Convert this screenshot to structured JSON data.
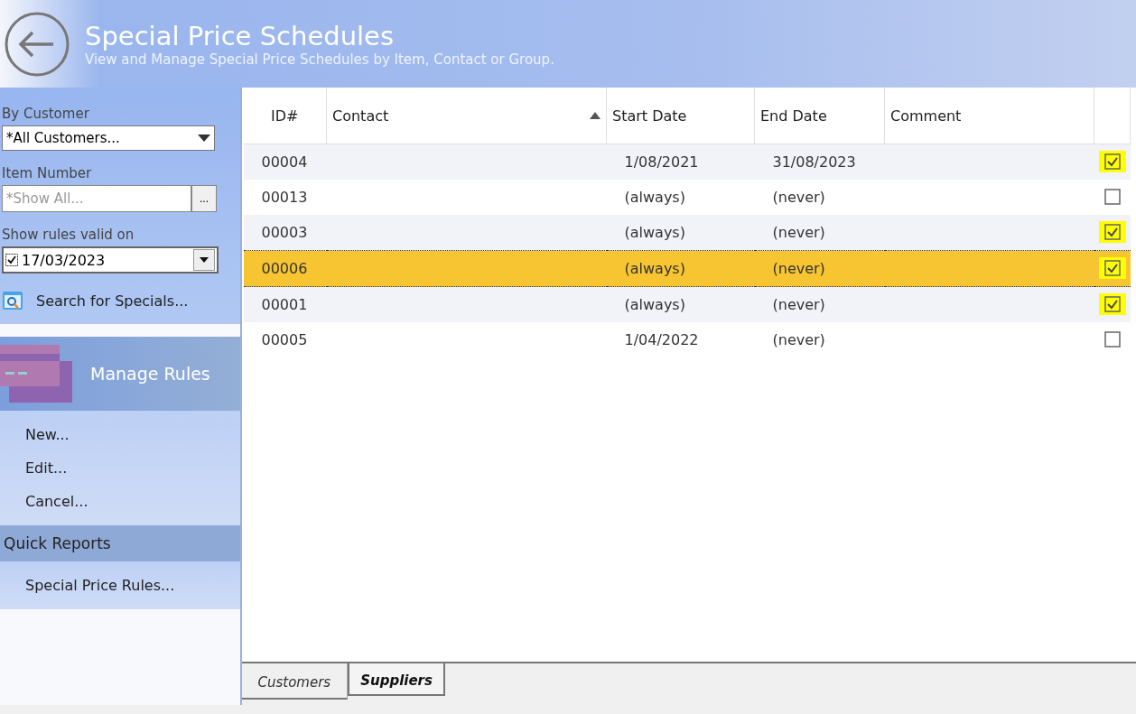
{
  "header": {
    "title": "Special Price Schedules",
    "subtitle": "View and Manage Special Price Schedules by Item, Contact or Group."
  },
  "filters": {
    "customer_label": "By Customer",
    "customer_value": "*All Customers...",
    "item_label": "Item Number",
    "item_placeholder": "*Show All...",
    "browse_button": "...",
    "date_label": "Show rules valid on",
    "date_checked": true,
    "date_value": "17/03/2023",
    "search_link": "Search for Specials..."
  },
  "manage_rules": {
    "title": "Manage Rules",
    "items": [
      "New...",
      "Edit...",
      "Cancel..."
    ]
  },
  "quick_reports": {
    "title": "Quick Reports",
    "items": [
      "Special Price Rules..."
    ]
  },
  "table": {
    "columns": [
      "ID#",
      "Contact",
      "Start Date",
      "End Date",
      "Comment"
    ],
    "rows": [
      {
        "id": "00004",
        "contact": "",
        "start": "1/08/2021",
        "end": "31/08/2023",
        "comment": "",
        "checked": true,
        "highlighted": true,
        "selected": false
      },
      {
        "id": "00013",
        "contact": "",
        "start": "(always)",
        "end": "(never)",
        "comment": "",
        "checked": false,
        "highlighted": false,
        "selected": false
      },
      {
        "id": "00003",
        "contact": "",
        "start": "(always)",
        "end": "(never)",
        "comment": "",
        "checked": true,
        "highlighted": true,
        "selected": false
      },
      {
        "id": "00006",
        "contact": "",
        "start": "(always)",
        "end": "(never)",
        "comment": "",
        "checked": true,
        "highlighted": true,
        "selected": true
      },
      {
        "id": "00001",
        "contact": "",
        "start": "(always)",
        "end": "(never)",
        "comment": "",
        "checked": true,
        "highlighted": true,
        "selected": false
      },
      {
        "id": "00005",
        "contact": "",
        "start": "1/04/2022",
        "end": "(never)",
        "comment": "",
        "checked": false,
        "highlighted": false,
        "selected": false
      }
    ]
  },
  "tabs": [
    {
      "label": "Customers",
      "selected": false
    },
    {
      "label": "Suppliers",
      "selected": true
    }
  ]
}
